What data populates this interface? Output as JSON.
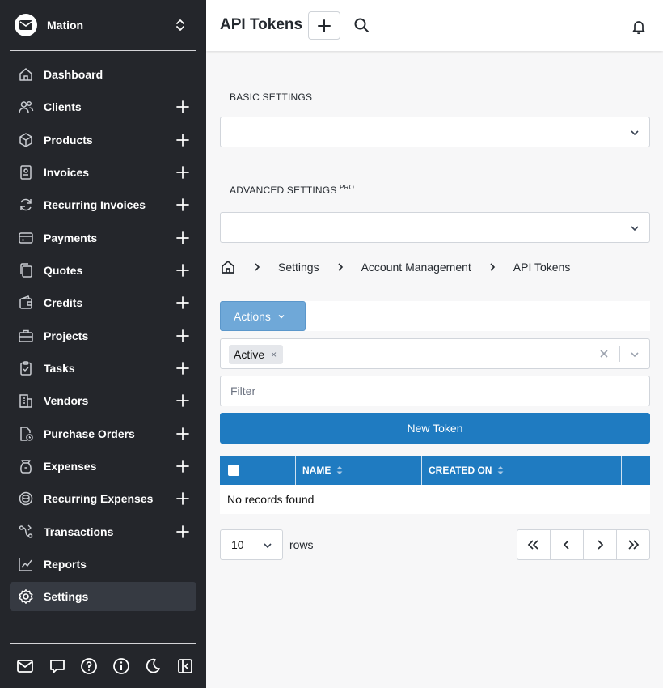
{
  "company": {
    "name": "Mation"
  },
  "sidebar": {
    "items": [
      {
        "label": "Dashboard",
        "icon": "home-icon",
        "has_add": false
      },
      {
        "label": "Clients",
        "icon": "users-icon",
        "has_add": true
      },
      {
        "label": "Products",
        "icon": "box-icon",
        "has_add": true
      },
      {
        "label": "Invoices",
        "icon": "invoice-icon",
        "has_add": true
      },
      {
        "label": "Recurring Invoices",
        "icon": "refresh-icon",
        "has_add": true
      },
      {
        "label": "Payments",
        "icon": "credit-card-icon",
        "has_add": true
      },
      {
        "label": "Quotes",
        "icon": "files-icon",
        "has_add": true
      },
      {
        "label": "Credits",
        "icon": "wallet-icon",
        "has_add": true
      },
      {
        "label": "Projects",
        "icon": "briefcase-icon",
        "has_add": true
      },
      {
        "label": "Tasks",
        "icon": "clipboard-check-icon",
        "has_add": true
      },
      {
        "label": "Vendors",
        "icon": "building-icon",
        "has_add": true
      },
      {
        "label": "Purchase Orders",
        "icon": "document-clock-icon",
        "has_add": true
      },
      {
        "label": "Expenses",
        "icon": "money-bag-icon",
        "has_add": true
      },
      {
        "label": "Recurring Expenses",
        "icon": "coins-refresh-icon",
        "has_add": true
      },
      {
        "label": "Transactions",
        "icon": "transfer-icon",
        "has_add": true
      },
      {
        "label": "Reports",
        "icon": "line-chart-icon",
        "has_add": false
      },
      {
        "label": "Settings",
        "icon": "gear-icon",
        "has_add": false,
        "active": true
      }
    ],
    "footer_icons": [
      "mail-icon",
      "chat-icon",
      "help-circle-icon",
      "info-circle-icon",
      "moon-icon",
      "collapse-sidebar-icon"
    ]
  },
  "header": {
    "title": "API Tokens"
  },
  "settings": {
    "basic_label": "BASIC SETTINGS",
    "advanced_label": "ADVANCED SETTINGS",
    "advanced_badge": "PRO"
  },
  "breadcrumb": [
    "Settings",
    "Account Management",
    "API Tokens"
  ],
  "toolbar": {
    "actions_label": "Actions",
    "status_tag": "Active",
    "filter_placeholder": "Filter",
    "new_token_label": "New Token"
  },
  "table": {
    "columns": [
      "NAME",
      "CREATED ON"
    ],
    "empty_message": "No records found"
  },
  "pagination": {
    "rows_per_page": "10",
    "rows_label": "rows"
  },
  "colors": {
    "sidebar_bg": "#24262b",
    "primary": "#1f7bc1",
    "actions_bg": "#6fa8d8"
  }
}
